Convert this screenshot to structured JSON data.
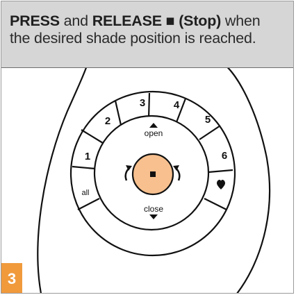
{
  "instruction": {
    "press": "PRESS",
    "and": " and ",
    "release": "RELEASE",
    "stop_symbol": " ■ ",
    "stop": "(Stop)",
    "line1_rest": " when",
    "line2": "the desired shade position is reached."
  },
  "remote": {
    "ring_buttons": [
      "1",
      "2",
      "3",
      "4",
      "5",
      "6",
      "all"
    ],
    "favorite_icon": "heart-icon",
    "open_label": "open",
    "close_label": "close",
    "stop_icon": "stop-square-icon",
    "tilt_left_icon": "tilt-left-arrow-icon",
    "tilt_right_icon": "tilt-right-arrow-icon"
  },
  "step_number": "3",
  "colors": {
    "header_bg": "#d6d6d7",
    "stop_button": "#f7c08e",
    "step_badge": "#f09a3c",
    "outline": "#111111"
  }
}
